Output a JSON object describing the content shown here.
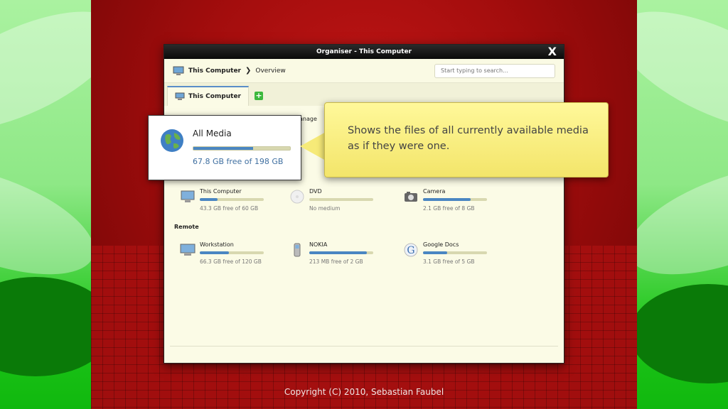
{
  "window": {
    "title": "Organiser - This Computer",
    "close_label": "X"
  },
  "navbar": {
    "root": "This Computer",
    "separator": "❯",
    "current": "Overview",
    "search_placeholder": "Start typing to search..."
  },
  "tabs": [
    {
      "label": "This Computer"
    }
  ],
  "tab_add_label": "+",
  "toolbar": {
    "manage_fragment": "anage"
  },
  "local_devices": [
    {
      "name": "This Computer",
      "free": "43.3 GB free of 60 GB",
      "fill": 0.28,
      "icon": "computer-icon"
    },
    {
      "name": "DVD",
      "free": "No medium",
      "fill": 0.0,
      "icon": "dvd-icon"
    },
    {
      "name": "Camera",
      "free": "2.1 GB free of 8 GB",
      "fill": 0.74,
      "icon": "camera-icon"
    }
  ],
  "remote": {
    "title": "Remote",
    "devices": [
      {
        "name": "Workstation",
        "free": "66.3 GB free of 120 GB",
        "fill": 0.45,
        "icon": "workstation-icon"
      },
      {
        "name": "NOKIA",
        "free": "213 MB free of 2 GB",
        "fill": 0.9,
        "icon": "phone-icon"
      },
      {
        "name": "Google Docs",
        "free": "3.1 GB free of 5 GB",
        "fill": 0.38,
        "icon": "google-icon"
      }
    ]
  },
  "all_media": {
    "title": "All Media",
    "free": "67.8 GB free of 198 GB",
    "fill": 0.62
  },
  "tooltip": {
    "text": "Shows the files of all currently available media as if they were one."
  },
  "footer": {
    "copyright": "Copyright (C) 2010, Sebastian Faubel"
  },
  "colors": {
    "accent": "#4a86c2",
    "stage": "#a30d0d",
    "tooltip": "#f6ea78"
  }
}
